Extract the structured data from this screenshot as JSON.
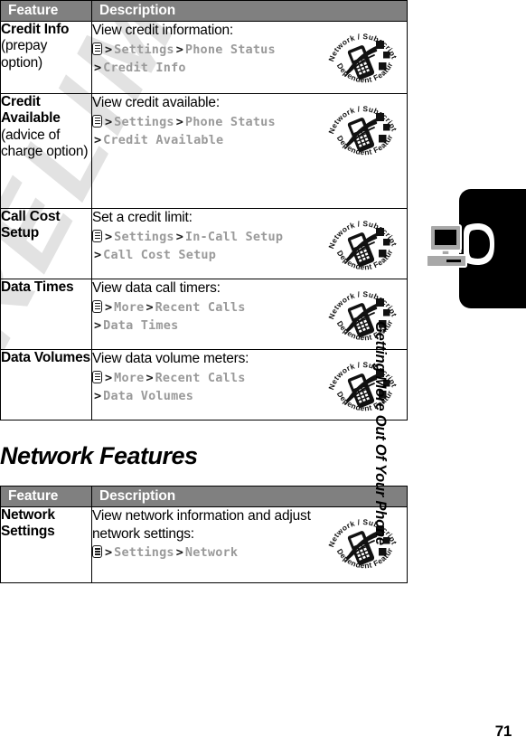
{
  "watermark": {
    "text": "PRELIMINARY"
  },
  "page": {
    "number": "71"
  },
  "sidebar": {
    "chapter_label": "Getting More Out Of Your Phone",
    "tab_icon": "computer-phone-icon"
  },
  "badge": {
    "top_text": "Network / Subscription",
    "bottom_text": "Dependent Feature",
    "icon": "network-dependent-feature-icon"
  },
  "menu_icon": "menu-key-icon",
  "separator": ">",
  "tables": [
    {
      "headers": {
        "feature": "Feature",
        "description": "Description"
      },
      "rows": [
        {
          "feature_name": "Credit Info",
          "feature_sub": "(prepay option)",
          "desc": "View credit information:",
          "path_line1": [
            "Settings",
            "Phone Status"
          ],
          "path_line2": [
            "Credit Info"
          ],
          "badge": true
        },
        {
          "feature_name": "Credit Available",
          "feature_sub": "(advice of charge option)",
          "desc": "View credit available:",
          "path_line1": [
            "Settings",
            "Phone Status"
          ],
          "path_line2": [
            "Credit Available"
          ],
          "badge": true
        },
        {
          "feature_name": "Call Cost Setup",
          "feature_sub": "",
          "desc": "Set a credit limit:",
          "path_line1": [
            "Settings",
            "In-Call Setup"
          ],
          "path_line2": [
            "Call Cost Setup"
          ],
          "badge": true
        },
        {
          "feature_name": "Data Times",
          "feature_sub": "",
          "desc": "View data call timers:",
          "path_line1": [
            "More",
            "Recent Calls"
          ],
          "path_line2": [
            "Data Times"
          ],
          "badge": true
        },
        {
          "feature_name": "Data Volumes",
          "feature_sub": "",
          "desc": "View data volume meters:",
          "path_line1": [
            "More",
            "Recent Calls"
          ],
          "path_line2": [
            "Data Volumes"
          ],
          "badge": true
        }
      ]
    },
    {
      "heading": "Network Features",
      "headers": {
        "feature": "Feature",
        "description": "Description"
      },
      "rows": [
        {
          "feature_name": "Network Settings",
          "feature_sub": "",
          "desc": "View network information and adjust network settings:",
          "path_line1": [
            "Settings",
            "Network"
          ],
          "path_line2": [],
          "badge": true
        }
      ]
    }
  ]
}
